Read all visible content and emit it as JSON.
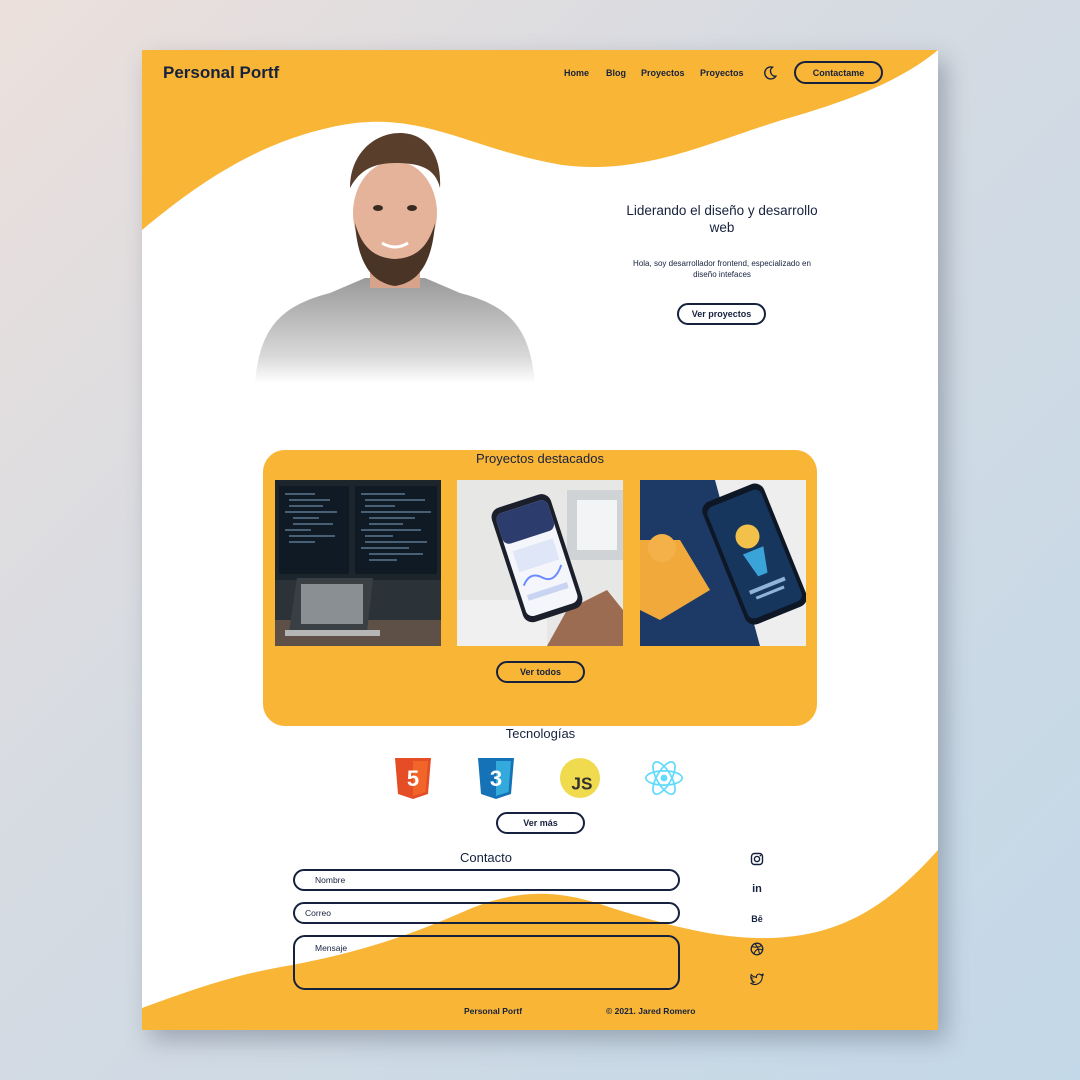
{
  "colors": {
    "accent": "#f9b536",
    "navy": "#16213d",
    "background": "#ffffff"
  },
  "header": {
    "logo": "Personal Portf",
    "nav": [
      "Home",
      "Blog",
      "Proyectos",
      "Proyectos"
    ],
    "theme_icon": "moon-icon",
    "cta": "Contactame"
  },
  "hero": {
    "title": "Liderando el diseño y desarrollo web",
    "subtitle": "Hola, soy desarrollador frontend, especializado en diseño intefaces",
    "button": "Ver proyectos"
  },
  "projects": {
    "title": "Proyectos destacados",
    "items": [
      "code-monitors-image",
      "phone-app-image",
      "illustration-phone-image"
    ],
    "button": "Ver todos"
  },
  "technologies": {
    "title": "Tecnologías",
    "icons": [
      "html5-icon",
      "css3-icon",
      "javascript-icon",
      "react-icon"
    ],
    "js_label": "JS",
    "html_label": "5",
    "css_label": "3",
    "button": "Ver más"
  },
  "contact": {
    "title": "Contacto",
    "name_placeholder": "Nombre",
    "email_placeholder": "Correo",
    "message_placeholder": "Mensaje"
  },
  "social": {
    "icons": [
      "instagram-icon",
      "linkedin-icon",
      "behance-icon",
      "dribbble-icon",
      "twitter-icon"
    ],
    "linkedin_label": "in",
    "behance_label": "Bē"
  },
  "footer": {
    "brand": "Personal Portf",
    "copyright": "© 2021. Jared Romero"
  }
}
